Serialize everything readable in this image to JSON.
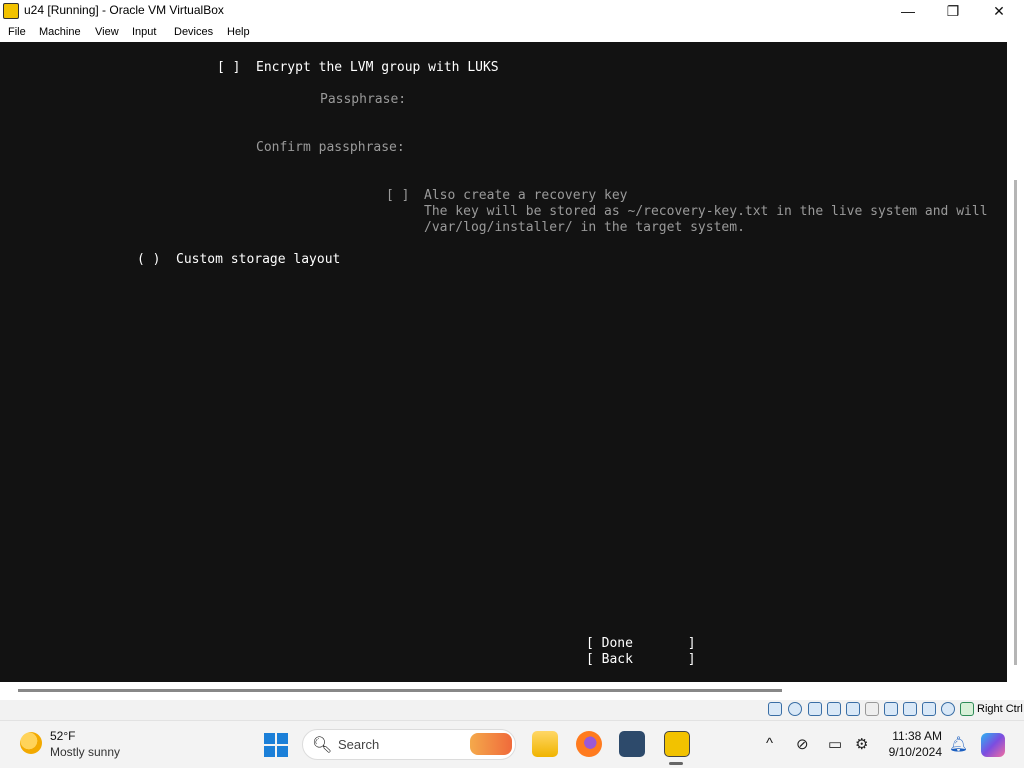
{
  "window": {
    "title": "u24 [Running] - Oracle VM VirtualBox",
    "controls": {
      "minimize": "—",
      "maximize": "❐",
      "close": "✕"
    }
  },
  "menu": [
    "File",
    "Machine",
    "View",
    "Input",
    "Devices",
    "Help"
  ],
  "installer": {
    "encrypt_checkbox": "[ ]",
    "encrypt_label": "Encrypt the LVM group with LUKS",
    "passphrase_label": "Passphrase:",
    "confirm_label": "Confirm passphrase:",
    "recovery_checkbox": "[ ]",
    "recovery_label": "Also create a recovery key",
    "recovery_desc_line1": "The key will be stored as ~/recovery-key.txt in the live system and will",
    "recovery_desc_line2": "/var/log/installer/ in the target system.",
    "custom_radio": "( )",
    "custom_label": "Custom storage layout",
    "done_button": "[ Done       ]",
    "back_button": "[ Back       ]"
  },
  "statusbar": {
    "host_key": "Right Ctrl"
  },
  "taskbar": {
    "weather_temp": "52°F",
    "weather_desc": "Mostly sunny",
    "search_placeholder": "Search",
    "time": "11:38 AM",
    "date": "9/10/2024"
  },
  "icons": {
    "start": "windows-icon",
    "search": "search-icon",
    "tray": [
      "chevron-up-icon",
      "network-off-icon",
      "display-icon",
      "settings-icon",
      "bell-icon",
      "copilot-icon"
    ]
  }
}
